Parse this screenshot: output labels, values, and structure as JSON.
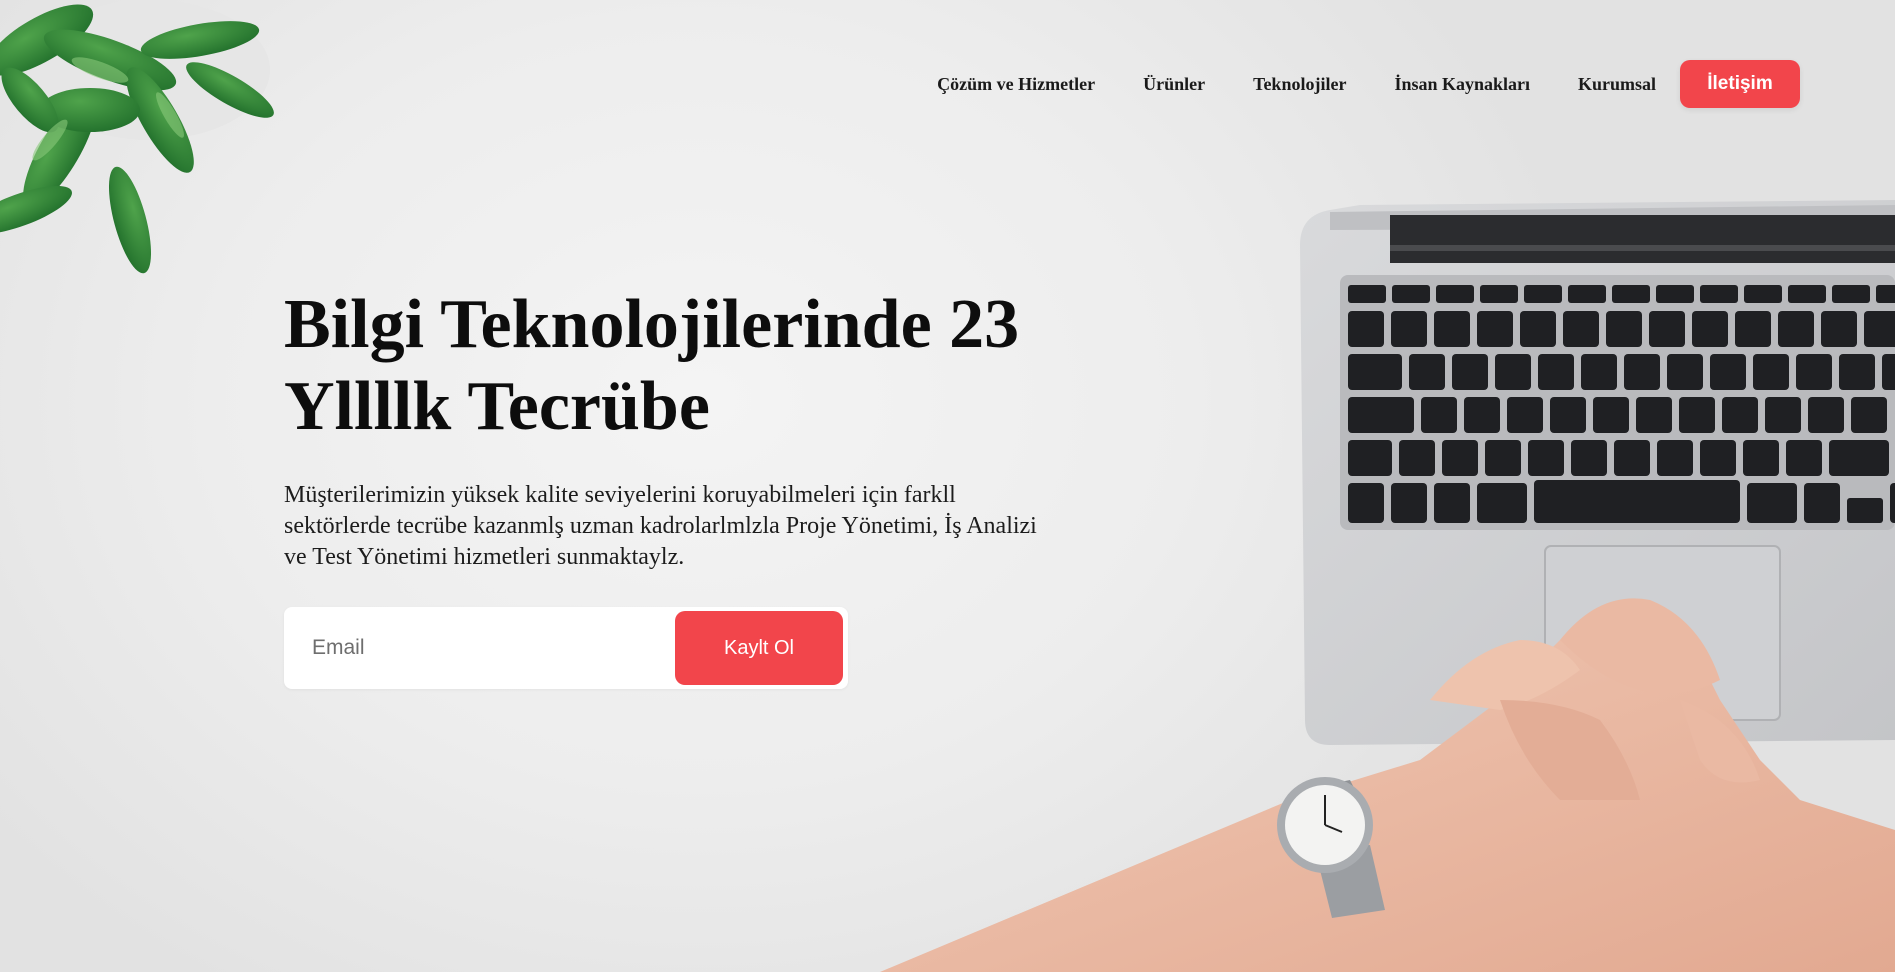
{
  "nav": {
    "items": [
      {
        "label": "Çözüm ve Hizmetler"
      },
      {
        "label": "Ürünler"
      },
      {
        "label": "Teknolojiler"
      },
      {
        "label": "İnsan Kaynakları"
      },
      {
        "label": "Kurumsal"
      }
    ],
    "cta_label": "İletişim"
  },
  "hero": {
    "title_line1": "Bilgi Teknolojilerinde 23",
    "title_line2": "Yllllk Tecrübe",
    "description": "Müşterilerimizin yüksek kalite seviyelerini koruyabilmeleri için farkll sektörlerde tecrübe kazanmlş uzman kadrolarlmlzla Proje Yönetimi, İş Analizi ve Test Yönetimi hizmetleri sunmaktaylz."
  },
  "signup": {
    "placeholder": "Email",
    "button_label": "Kaylt Ol"
  },
  "colors": {
    "accent": "#f2454b",
    "text": "#0d0d0d",
    "background": "#ececec"
  },
  "decor": {
    "plant": "succulent-plant-image",
    "laptop": "laptop-image",
    "hands": "clasped-hands-with-watch-image"
  }
}
